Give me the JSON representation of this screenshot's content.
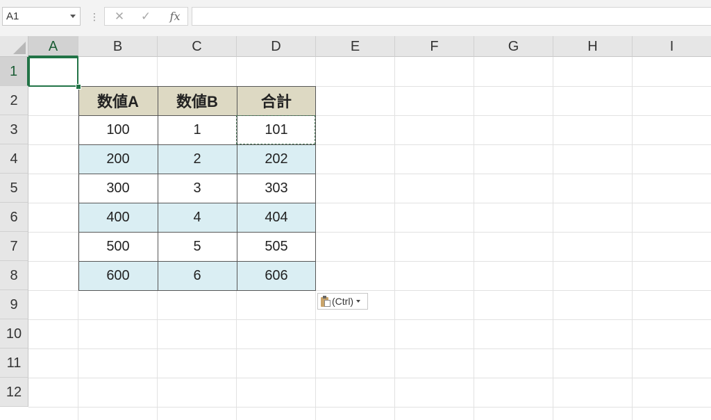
{
  "formula_bar": {
    "name_box": "A1",
    "fx_label": "fx",
    "formula": ""
  },
  "columns": [
    "A",
    "B",
    "C",
    "D",
    "E",
    "F",
    "G",
    "H",
    "I"
  ],
  "rows": [
    "1",
    "2",
    "3",
    "4",
    "5",
    "6",
    "7",
    "8",
    "9",
    "10",
    "11",
    "12"
  ],
  "table": {
    "headers": [
      "数値A",
      "数値B",
      "合計"
    ],
    "rows": [
      [
        "100",
        "1",
        "101"
      ],
      [
        "200",
        "2",
        "202"
      ],
      [
        "300",
        "3",
        "303"
      ],
      [
        "400",
        "4",
        "404"
      ],
      [
        "500",
        "5",
        "505"
      ],
      [
        "600",
        "6",
        "606"
      ]
    ]
  },
  "paste_options": {
    "label": "(Ctrl)"
  },
  "colors": {
    "header_fill": "#ddd9c3",
    "band_fill": "#daeef3",
    "selection": "#217346"
  }
}
